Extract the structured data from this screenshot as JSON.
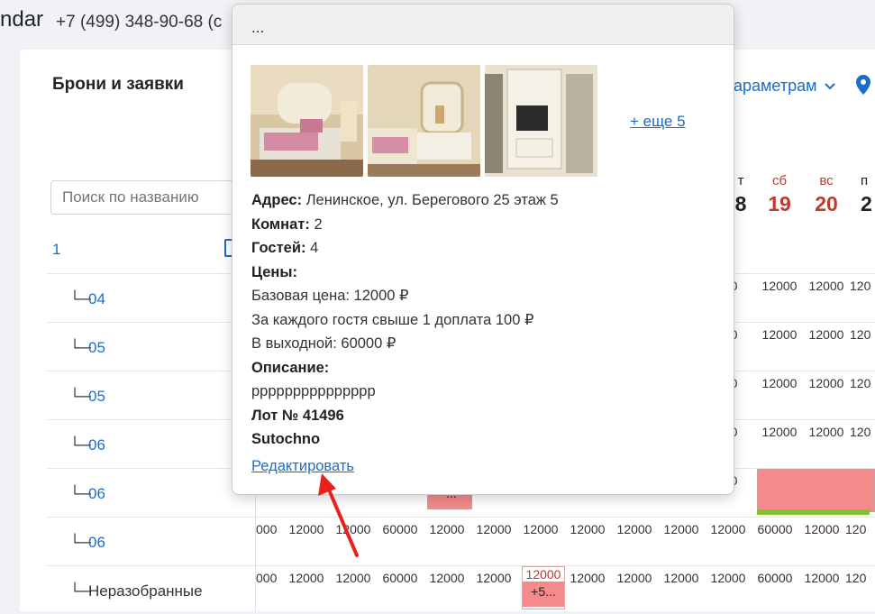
{
  "header": {
    "app_name": "ndar",
    "phone": "+7 (499) 348-90-68  (c"
  },
  "page": {
    "title": "Брони и заявки",
    "filter_label": "араметрам",
    "search_placeholder": "Поиск по названию"
  },
  "sidebar": {
    "root": "1",
    "rows": [
      {
        "label": "04"
      },
      {
        "label": "05"
      },
      {
        "label": "05"
      },
      {
        "label": "06"
      },
      {
        "label": "06"
      },
      {
        "label": "06"
      },
      {
        "label": "Неразобранные"
      }
    ]
  },
  "calendar": {
    "days": [
      {
        "dow": "т",
        "num": "8"
      },
      {
        "dow": "сб",
        "num": "19"
      },
      {
        "dow": "вс",
        "num": "20"
      },
      {
        "dow": "п",
        "num": "2"
      }
    ],
    "row_prices_right": [
      "000",
      "12000",
      "12000",
      "120"
    ],
    "row_prices_full": [
      "000",
      "12000",
      "12000",
      "60000",
      "12000",
      "12000",
      "12000",
      "12000",
      "12000",
      "12000",
      "12000",
      "60000",
      "12000",
      "12000",
      "120"
    ],
    "row_prices_last": [
      "000",
      "12000",
      "12000",
      "60000",
      "12000",
      "12000",
      "",
      "12000",
      "12000",
      "12000",
      "12000",
      "60000",
      "12000",
      "12000",
      "120"
    ],
    "booking_partial_text": "...",
    "price_tag": {
      "price": "12000",
      "label": "+5..."
    }
  },
  "popover": {
    "title": "...",
    "more_photos": "+ еще 5",
    "address_label": "Адрес:",
    "address_value": "Ленинское, ул. Берегового 25 этаж 5",
    "rooms_label": "Комнат:",
    "rooms_value": "2",
    "guests_label": "Гостей:",
    "guests_value": "4",
    "prices_label": "Цены:",
    "base_price": "Базовая цена: 12000 ₽",
    "extra_guest": "За каждого гостя свыше 1 доплата 100 ₽",
    "weekend": "В выходной: 60000 ₽",
    "description_label": "Описание:",
    "description": "ррррррррррррррр",
    "lot": "Лот № 41496",
    "source": "Sutochno",
    "edit_link": "Редактировать"
  },
  "colors": {
    "link": "#1a6dcc",
    "weekend": "#c0392b",
    "booking": "#f58a8a",
    "arrow": "#e8211c"
  }
}
